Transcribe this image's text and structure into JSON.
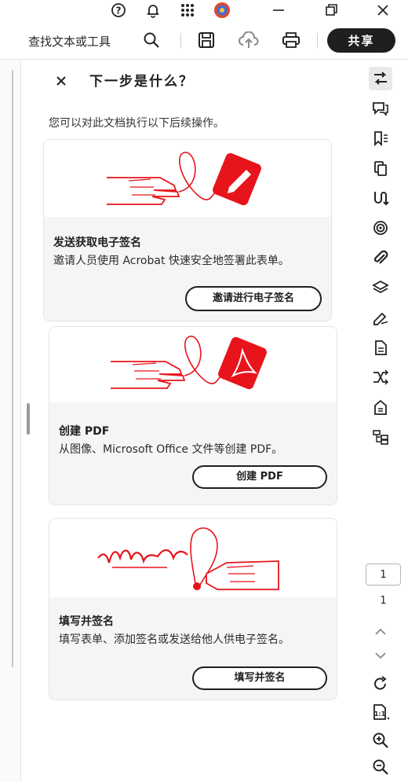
{
  "search": {
    "label": "查找文本或工具"
  },
  "toolbar": {
    "share_label": "共享"
  },
  "panel": {
    "title": "下一步是什么？",
    "subtitle": "您可以对此文档执行以下后续操作。",
    "cards": [
      {
        "title": "发送获取电子签名",
        "desc": "邀请人员使用 Acrobat 快速安全地签署此表单。",
        "button": "邀请进行电子签名"
      },
      {
        "title": "创建 PDF",
        "desc": "从图像、Microsoft Office 文件等创建 PDF。",
        "button": "创建 PDF"
      },
      {
        "title": "填写并签名",
        "desc": "填写表单、添加签名或发送给他人供电子签名。",
        "button": "填写并签名"
      }
    ]
  },
  "page_nav": {
    "current": "1",
    "total": "1"
  },
  "colors": {
    "accent_red": "#e8141b",
    "dark": "#1f1f1f",
    "card_body": "#f5f5f5"
  },
  "icons": {
    "topbar": [
      "help-icon",
      "notification-bell-icon",
      "apps-grid-icon",
      "profile-avatar",
      "minimize-icon",
      "restore-icon",
      "close-window-icon"
    ],
    "toolbar": [
      "search-icon",
      "save-icon",
      "cloud-upload-icon",
      "print-icon"
    ],
    "rightrail": [
      "next-steps-icon",
      "comment-icon",
      "bookmark-icon",
      "pages-icon",
      "combine-icon",
      "redact-icon",
      "attachment-icon",
      "layers-icon",
      "sign-icon",
      "export-icon",
      "compare-icon",
      "scan-icon",
      "organize-icon",
      "rotate-icon",
      "fit-page-icon",
      "zoom-in-icon",
      "zoom-out-icon"
    ]
  }
}
